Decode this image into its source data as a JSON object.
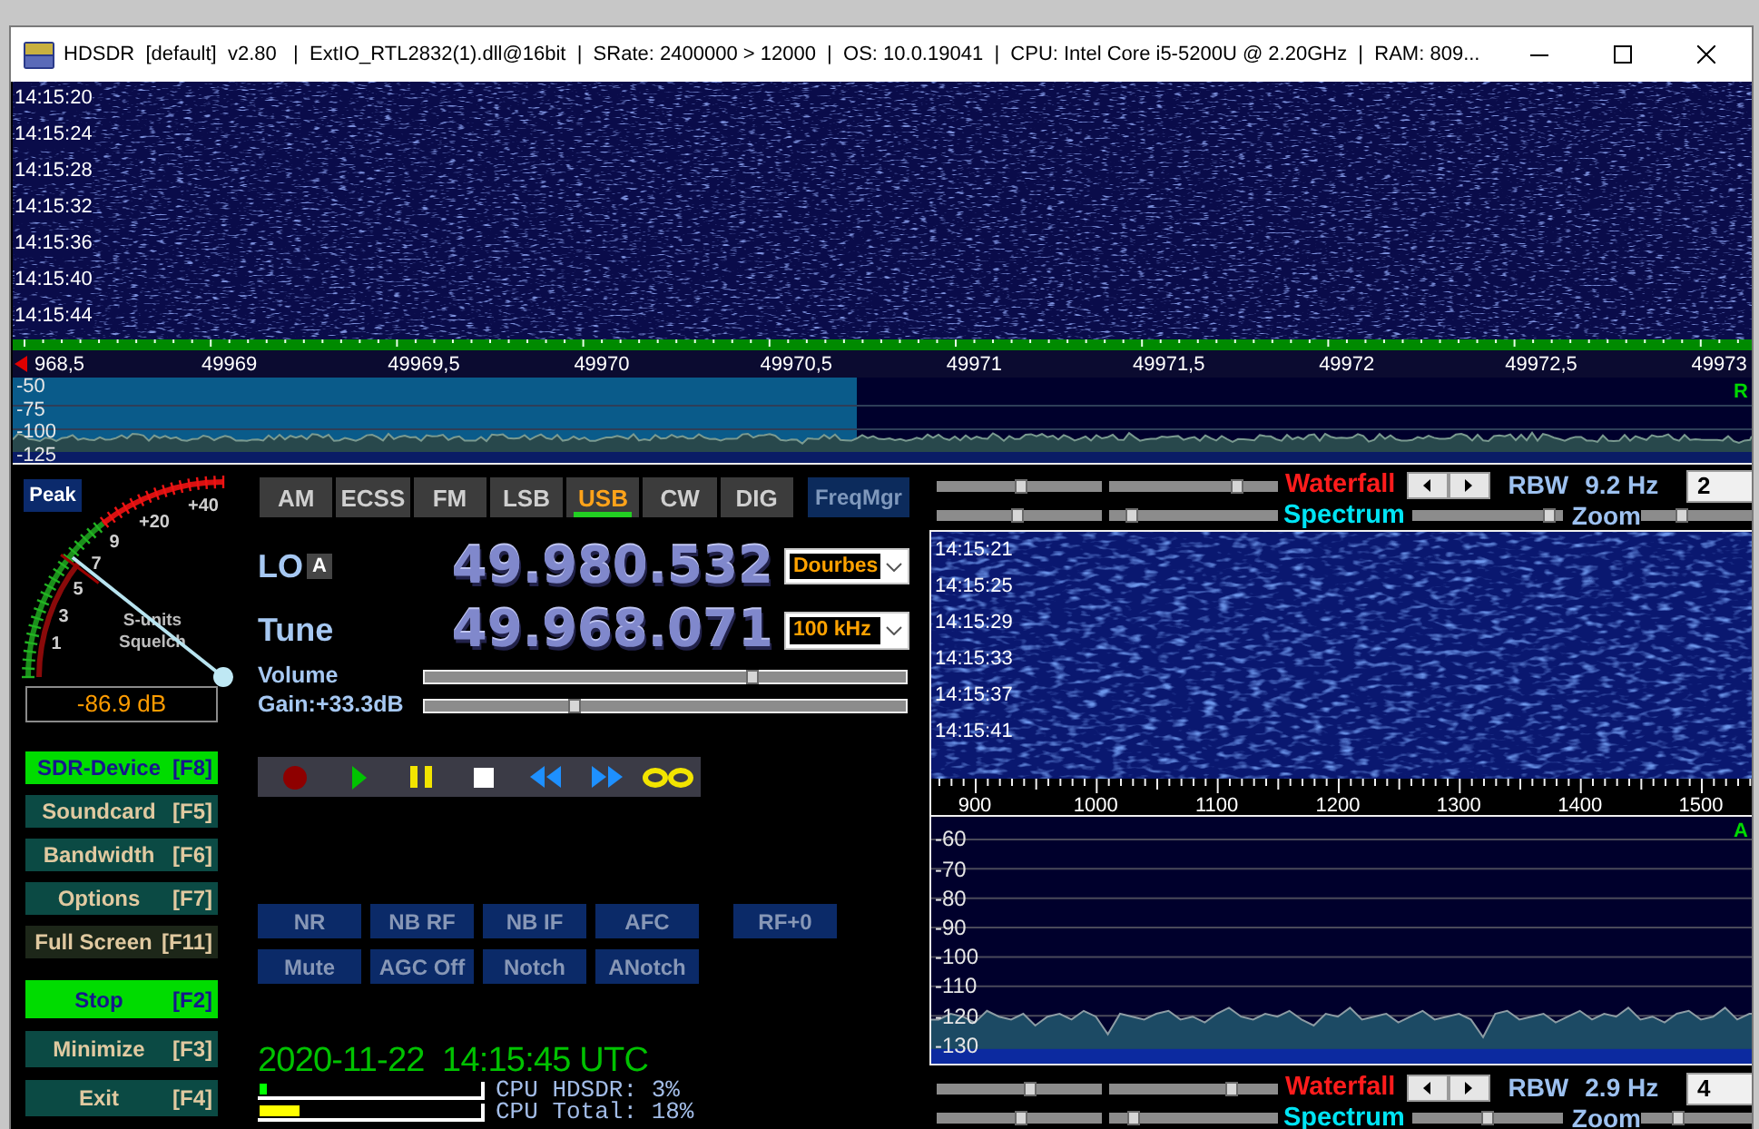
{
  "window": {
    "title": "HDSDR  [default]  v2.80   |  ExtIO_RTL2832(1).dll@16bit  |  SRate: 2400000 > 12000  |  OS: 10.0.19041  |  CPU: Intel Core i5-5200U @ 2.20GHz  |  RAM: 809..."
  },
  "main_waterfall": {
    "times": [
      "14:15:20",
      "14:15:24",
      "14:15:28",
      "14:15:32",
      "14:15:36",
      "14:15:40",
      "14:15:44"
    ]
  },
  "frequency_scale": {
    "labels": [
      "968,5",
      "49969",
      "49969,5",
      "49970",
      "49970,5",
      "49971",
      "49971,5",
      "49972",
      "49972,5",
      "49973"
    ]
  },
  "main_spectrum": {
    "db_labels": [
      "-50",
      "-75",
      "-100",
      "-125"
    ],
    "indicator": "R"
  },
  "s_meter": {
    "peak_button": "Peak",
    "scale_labels": [
      "+40",
      "+20",
      "9",
      "7",
      "5",
      "3",
      "1"
    ],
    "captions": [
      "S-units",
      "Squelch"
    ],
    "reading": "-86.9 dB"
  },
  "modes": [
    {
      "label": "AM",
      "selected": false
    },
    {
      "label": "ECSS",
      "selected": false
    },
    {
      "label": "FM",
      "selected": false
    },
    {
      "label": "LSB",
      "selected": false
    },
    {
      "label": "USB",
      "selected": true
    },
    {
      "label": "CW",
      "selected": false
    },
    {
      "label": "DIG",
      "selected": false
    }
  ],
  "freq_manager": "FreqMgr",
  "lo": {
    "label": "LO",
    "vfo": "A",
    "frequency": "49.980.532",
    "preset": "Dourbes"
  },
  "tune": {
    "label": "Tune",
    "frequency": "49.968.071",
    "step": "100 kHz"
  },
  "volume": {
    "label": "Volume",
    "level": 0.68
  },
  "gain": {
    "label": "Gain:+33.3dB",
    "level": 0.31
  },
  "side_buttons": [
    {
      "label": "SDR-Device",
      "key": "[F8]",
      "kind": "command",
      "on": true
    },
    {
      "label": "Soundcard",
      "key": "[F5]",
      "kind": "command",
      "on": false
    },
    {
      "label": "Bandwidth",
      "key": "[F6]",
      "kind": "command",
      "on": false
    },
    {
      "label": "Options",
      "key": "[F7]",
      "kind": "command",
      "on": false
    },
    {
      "label": "Full Screen",
      "key": "[F11]",
      "kind": "toggle",
      "on": false
    }
  ],
  "run_buttons": [
    {
      "label": "Stop",
      "key": "[F2]",
      "on": true
    },
    {
      "label": "Minimize",
      "key": "[F3]",
      "on": false
    },
    {
      "label": "Exit",
      "key": "[F4]",
      "on": false
    }
  ],
  "dsp_buttons": [
    [
      "NR",
      "NB RF",
      "NB IF",
      "AFC"
    ],
    [
      "Mute",
      "AGC Off",
      "Notch",
      "ANotch"
    ]
  ],
  "rf_button": "RF+0",
  "clock": "2020-11-22  14:15:45 UTC",
  "cpu": [
    {
      "label": "CPU HDSDR: 3%",
      "level": 0.03,
      "color": "#00ff00"
    },
    {
      "label": "CPU Total: 18%",
      "level": 0.18,
      "color": "#ffff00"
    }
  ],
  "af_top_controls": {
    "waterfall_sliders": [
      {
        "level": 0.51
      },
      {
        "level": 0.75
      }
    ],
    "waterfall_label": "Waterfall",
    "rbw_label": "RBW",
    "rbw_value": "9.2 Hz",
    "speed": "2",
    "spectrum_sliders": [
      {
        "level": 0.48
      },
      {
        "level": 0.13
      }
    ],
    "spectrum_label": "Spectrum",
    "zoom_sliders": [
      {
        "level": 0.9
      },
      {
        "level": 0.34
      }
    ],
    "zoom_label": "Zoom"
  },
  "af_waterfall": {
    "times": [
      "14:15:21",
      "14:15:25",
      "14:15:29",
      "14:15:33",
      "14:15:37",
      "14:15:41"
    ]
  },
  "af_spectrum": {
    "indicator": "A",
    "chart_data": {
      "type": "area",
      "grid": true,
      "xlim": [
        864,
        1542
      ],
      "ylim": [
        -136,
        -52
      ],
      "xticks": [
        900,
        1000,
        1100,
        1200,
        1300,
        1400,
        1500
      ],
      "yticks": [
        -60,
        -70,
        -80,
        -90,
        -100,
        -110,
        -120,
        -130
      ],
      "x": [
        870,
        880,
        890,
        900,
        910,
        920,
        930,
        940,
        950,
        960,
        970,
        980,
        990,
        1000,
        1010,
        1020,
        1030,
        1040,
        1050,
        1060,
        1070,
        1080,
        1090,
        1100,
        1110,
        1120,
        1130,
        1140,
        1150,
        1160,
        1170,
        1180,
        1190,
        1200,
        1210,
        1220,
        1230,
        1240,
        1250,
        1260,
        1270,
        1280,
        1290,
        1300,
        1310,
        1320,
        1330,
        1340,
        1350,
        1360,
        1370,
        1380,
        1390,
        1400,
        1410,
        1420,
        1430,
        1440,
        1450,
        1460,
        1470,
        1480,
        1490,
        1500,
        1510,
        1520,
        1530,
        1540
      ],
      "series": [
        {
          "color": "#1c4a64",
          "values": [
            -121,
            -119,
            -120,
            -122,
            -118,
            -120,
            -121,
            -119,
            -123,
            -120,
            -119,
            -121,
            -118,
            -120,
            -126,
            -119,
            -120,
            -121,
            -119,
            -118,
            -121,
            -120,
            -122,
            -119,
            -117,
            -120,
            -121,
            -119,
            -120,
            -118,
            -121,
            -123,
            -119,
            -120,
            -117,
            -121,
            -120,
            -119,
            -122,
            -120,
            -118,
            -121,
            -120,
            -119,
            -121,
            -127,
            -119,
            -118,
            -121,
            -120,
            -119,
            -122,
            -120,
            -118,
            -121,
            -119,
            -120,
            -117,
            -121,
            -120,
            -122,
            -119,
            -118,
            -121,
            -120,
            -117,
            -121,
            -119
          ]
        }
      ],
      "bands": [
        {
          "axis": "y",
          "from": -136,
          "to": -131,
          "color": "#0c2aa0"
        }
      ]
    }
  },
  "af_bottom_controls": {
    "waterfall_sliders": [
      {
        "level": 0.56
      },
      {
        "level": 0.72
      }
    ],
    "waterfall_label": "Waterfall",
    "rbw_label": "RBW",
    "rbw_value": "2.9 Hz",
    "speed": "4",
    "spectrum_sliders": [
      {
        "level": 0.51
      },
      {
        "level": 0.14
      }
    ],
    "spectrum_label": "Spectrum",
    "zoom_sliders": [
      {
        "level": 0.49
      },
      {
        "level": 0.31
      }
    ],
    "zoom_label": "Zoom"
  }
}
